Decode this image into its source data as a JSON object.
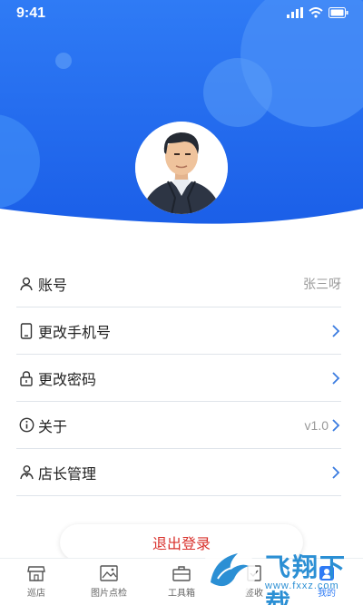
{
  "status_bar": {
    "time": "9:41"
  },
  "colors": {
    "header_top": "#2f7bf5",
    "header_bottom": "#1f63e6",
    "logout_text": "#d9322d",
    "tab_active": "#2f7bf5",
    "chevron": "#3a7be0"
  },
  "menu": [
    {
      "name": "account",
      "icon": "user-icon",
      "label": "账号",
      "value": "张三呀",
      "chevron": false
    },
    {
      "name": "change-phone",
      "icon": "phone-icon",
      "label": "更改手机号",
      "value": "",
      "chevron": true
    },
    {
      "name": "change-password",
      "icon": "lock-icon",
      "label": "更改密码",
      "value": "",
      "chevron": true
    },
    {
      "name": "about",
      "icon": "info-icon",
      "label": "关于",
      "value": "v1.0",
      "chevron": true
    },
    {
      "name": "manager",
      "icon": "users-icon",
      "label": "店长管理",
      "value": "",
      "chevron": true
    }
  ],
  "logout": {
    "label": "退出登录"
  },
  "tabs": [
    {
      "label": "巡店",
      "icon": "store-icon",
      "active": false
    },
    {
      "label": "图片点检",
      "icon": "image-icon",
      "active": false
    },
    {
      "label": "工具箱",
      "icon": "toolbox-icon",
      "active": false
    },
    {
      "label": "签收",
      "icon": "sign-icon",
      "active": false
    },
    {
      "label": "我的",
      "icon": "profile-icon",
      "active": true
    }
  ],
  "watermark": {
    "title": "飞翔下载",
    "url": "www.fxxz.com"
  }
}
